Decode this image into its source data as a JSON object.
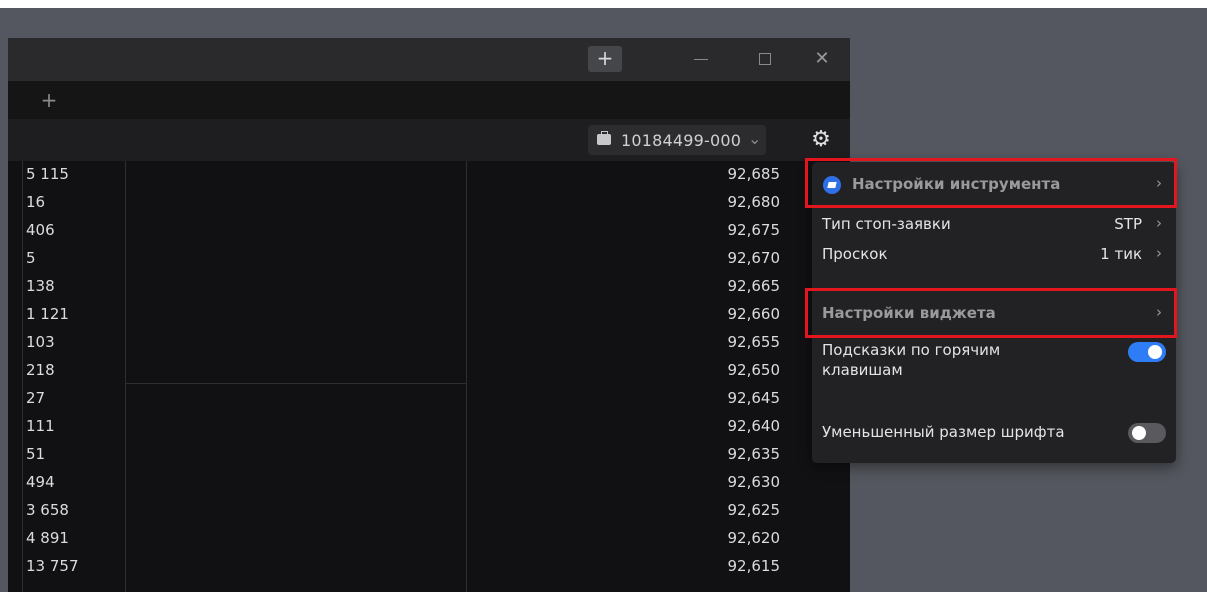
{
  "titlebar": {
    "add_label": "+",
    "minimize_label": "",
    "maximize_label": "",
    "close_label": "✕"
  },
  "tabbar": {
    "add_label": "+"
  },
  "toolbar": {
    "account_number": "10184499-000",
    "account_chevron": "⌄",
    "settings_icon": "gear-icon"
  },
  "rows": [
    {
      "volume": "5 115",
      "price": "92,685"
    },
    {
      "volume": "16",
      "price": "92,680"
    },
    {
      "volume": "406",
      "price": "92,675"
    },
    {
      "volume": "5",
      "price": "92,670"
    },
    {
      "volume": "138",
      "price": "92,665"
    },
    {
      "volume": "1 121",
      "price": "92,660"
    },
    {
      "volume": "103",
      "price": "92,655"
    },
    {
      "volume": "218",
      "price": "92,650"
    },
    {
      "volume": "27",
      "price": "92,645"
    },
    {
      "volume": "111",
      "price": "92,640"
    },
    {
      "volume": "51",
      "price": "92,635"
    },
    {
      "volume": "494",
      "price": "92,630"
    },
    {
      "volume": "3 658",
      "price": "92,625"
    },
    {
      "volume": "4 891",
      "price": "92,620"
    },
    {
      "volume": "13 757",
      "price": "92,615"
    }
  ],
  "menu": {
    "instrument_settings": "Настройки инструмента",
    "stop_order_type_label": "Тип стоп-заявки",
    "stop_order_type_value": "STP",
    "slippage_label": "Проскок",
    "slippage_value": "1 тик",
    "widget_settings": "Настройки виджета",
    "hotkey_hints_label": "Подсказки по горячим клавишам",
    "hotkey_hints_enabled": true,
    "small_font_label": "Уменьшенный размер шрифта",
    "small_font_enabled": false,
    "chevron": "›"
  },
  "colors": {
    "highlight_red": "#e3161f",
    "toggle_on": "#2f7df6",
    "instrument_icon": "#2f6fe8"
  }
}
